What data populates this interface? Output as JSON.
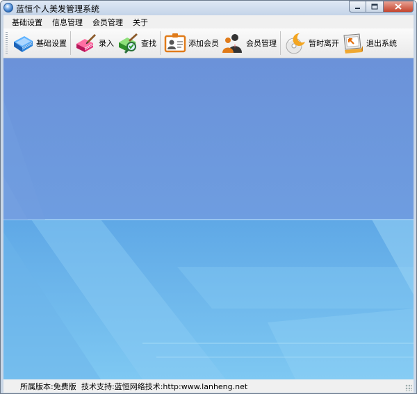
{
  "window": {
    "title": "蓝恒个人美发管理系统",
    "controls": [
      "minimize",
      "maximize",
      "close"
    ]
  },
  "menu": {
    "items": [
      "基础设置",
      "信息管理",
      "会员管理",
      "关于"
    ]
  },
  "toolbar": {
    "buttons": [
      {
        "label": "基础设置",
        "icon": "blue-book-icon"
      },
      {
        "label": "录入",
        "icon": "pink-book-pen-icon"
      },
      {
        "label": "查找",
        "icon": "green-book-search-icon"
      },
      {
        "label": "添加会员",
        "icon": "member-card-icon"
      },
      {
        "label": "会员管理",
        "icon": "people-icon"
      },
      {
        "label": "暂时离开",
        "icon": "moon-disc-icon"
      },
      {
        "label": "退出系统",
        "icon": "exit-monitor-icon"
      }
    ]
  },
  "statusbar": {
    "edition": "所属版本:免费版",
    "support": "技术支持:蓝恒网络技术:http:www.lanheng.net"
  },
  "colors": {
    "content_top": "#6e97dc",
    "content_bottom": "#7bc3ef",
    "titlebar": "#c9d6e6"
  }
}
